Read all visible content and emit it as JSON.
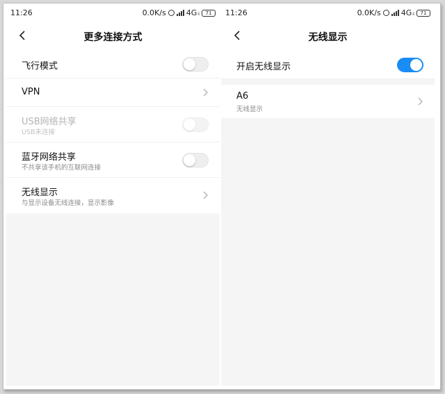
{
  "colors": {
    "accent": "#1a8cf5",
    "background": "#f5f5f5",
    "surface": "#ffffff"
  },
  "left": {
    "status": {
      "time": "11:26",
      "speed": "0.0K/s",
      "network": "4G",
      "battery": "71"
    },
    "title": "更多连接方式",
    "items": [
      {
        "title": "飞行模式",
        "control": "toggle",
        "on": false
      },
      {
        "title": "VPN",
        "control": "chevron"
      },
      {
        "title": "USB网络共享",
        "subtitle": "USB未连接",
        "control": "toggle",
        "on": false,
        "disabled": true
      },
      {
        "title": "蓝牙网络共享",
        "subtitle": "不共享该手机的互联网连接",
        "control": "toggle",
        "on": false
      },
      {
        "title": "无线显示",
        "subtitle": "与显示设备无线连接，显示影像",
        "control": "chevron"
      }
    ]
  },
  "right": {
    "status": {
      "time": "11:26",
      "speed": "0.0K/s",
      "network": "4G",
      "battery": "71"
    },
    "title": "无线显示",
    "enable": {
      "title": "开启无线显示",
      "on": true
    },
    "devices": [
      {
        "title": "A6",
        "subtitle": "无线显示"
      }
    ]
  }
}
